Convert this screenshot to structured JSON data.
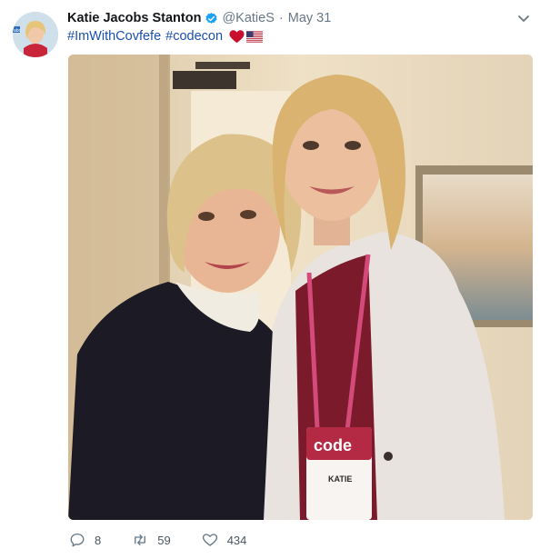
{
  "tweet": {
    "author": {
      "name": "Katie Jacobs Stanton",
      "handle": "@KatieS",
      "verified_icon": "verified-badge-icon"
    },
    "separator": "·",
    "date": "May 31",
    "hashtags": [
      "#ImWithCovfefe",
      "#codecon"
    ],
    "emojis": [
      "red-heart-emoji",
      "us-flag-emoji"
    ],
    "menu_icon": "chevron-down-icon",
    "photo": {
      "badge_brand": "code",
      "badge_name": "KATIE"
    },
    "actions": {
      "reply": {
        "icon": "reply-icon",
        "count": "8"
      },
      "retweet": {
        "icon": "retweet-icon",
        "count": "59"
      },
      "like": {
        "icon": "heart-icon",
        "count": "434"
      }
    }
  },
  "colors": {
    "link": "#1b4fae",
    "muted": "#657786",
    "verified": "#1da1f2",
    "heart": "#e0245e"
  }
}
